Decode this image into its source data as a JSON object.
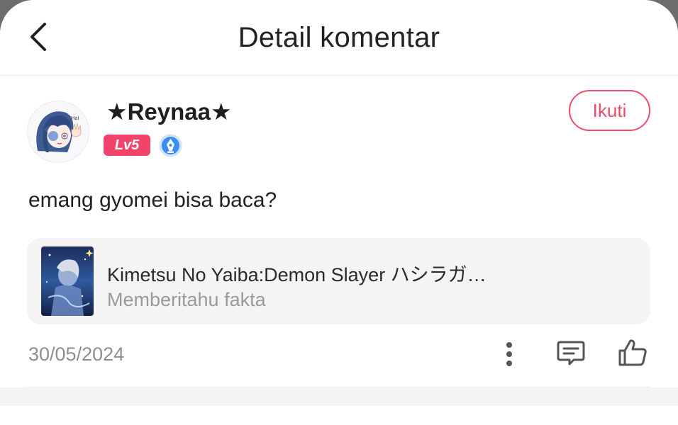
{
  "header": {
    "title": "Detail komentar",
    "back_icon": "chevron-left-icon"
  },
  "user": {
    "name": "★Reynaa★",
    "level": "Lv5",
    "badge_icon": "pen-nib-badge-icon",
    "follow_label": "Ikuti"
  },
  "comment": {
    "text": "emang gyomei bisa baca?",
    "date": "30/05/2024"
  },
  "book": {
    "title": "Kimetsu No Yaiba:Demon Slayer ハシラガ…",
    "subtitle": "Memberitahu fakta"
  },
  "actions": {
    "more_icon": "more-vertical-icon",
    "reply_icon": "comment-icon",
    "like_icon": "thumbs-up-icon"
  },
  "colors": {
    "accent": "#ec4d6a",
    "level_badge": "#f2446b",
    "card_bg": "#f4f4f5"
  }
}
